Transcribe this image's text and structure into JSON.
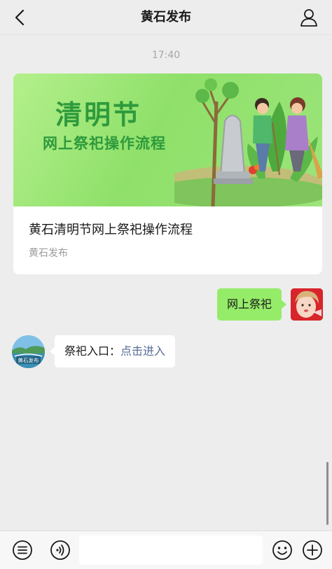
{
  "header": {
    "title": "黄石发布",
    "back_icon": "chevron-left-icon",
    "profile_icon": "person-icon"
  },
  "chat": {
    "timestamp": "17:40",
    "article_card": {
      "banner_title": "清明节",
      "banner_subtitle": "网上祭祀操作流程",
      "title": "黄石清明节网上祭祀操作流程",
      "source": "黄石发布"
    },
    "user_message": "网上祭祀",
    "reply": {
      "text": "祭祀入口：",
      "link": "点击进入"
    },
    "official_avatar_label": "黄石发布"
  },
  "input_bar": {
    "menu_icon": "menu-list-icon",
    "voice_icon": "voice-icon",
    "emoji_icon": "emoji-icon",
    "add_icon": "plus-icon",
    "input_value": ""
  },
  "colors": {
    "background": "#ededed",
    "sent_bubble": "#95ec69",
    "link": "#576b95",
    "banner_green": "#2e9a3c"
  }
}
